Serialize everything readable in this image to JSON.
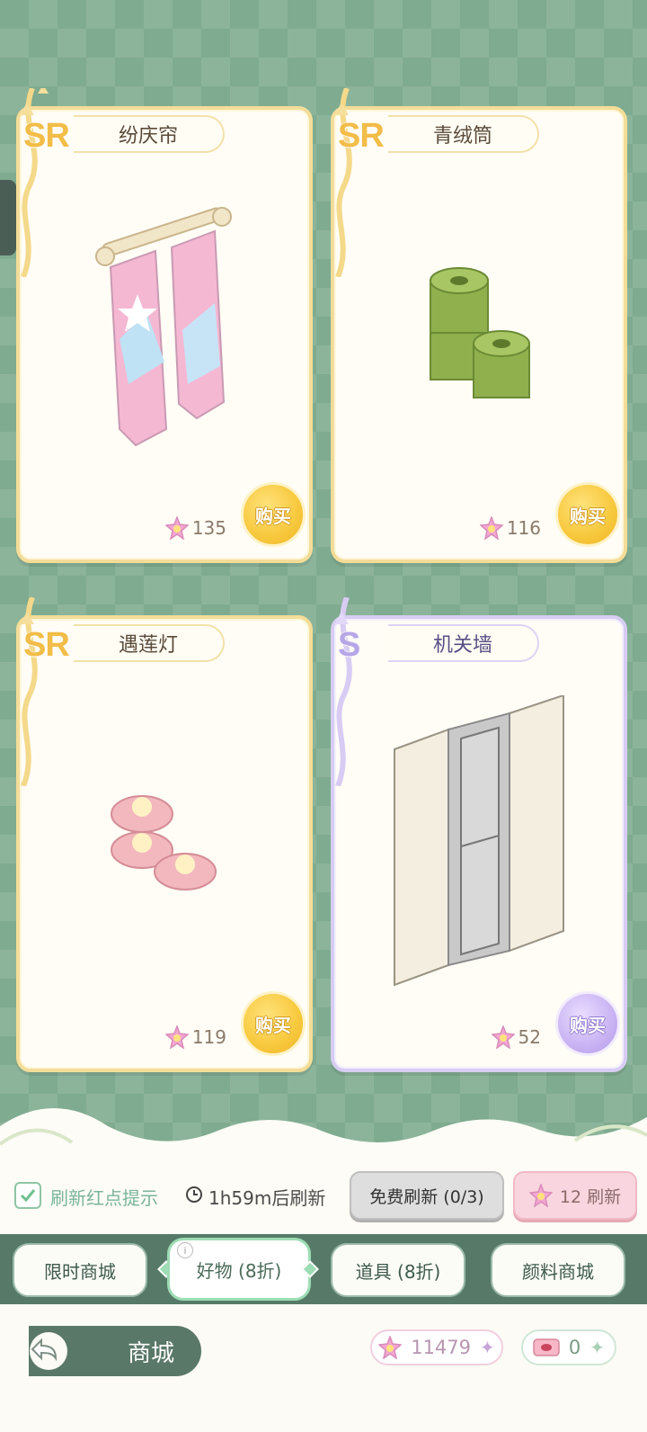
{
  "items": [
    {
      "rarity": "SR",
      "name": "纷庆帘",
      "price": "135",
      "buy_label": "购买"
    },
    {
      "rarity": "SR",
      "name": "青绒筒",
      "price": "116",
      "buy_label": "购买"
    },
    {
      "rarity": "SR",
      "name": "遇莲灯",
      "price": "119",
      "buy_label": "购买"
    },
    {
      "rarity": "S",
      "name": "机关墙",
      "price": "52",
      "buy_label": "购买"
    }
  ],
  "refresh": {
    "reminder_label": "刷新红点提示",
    "reminder_checked": true,
    "timer": "1h59m后刷新",
    "free_button": "免费刷新 (0/3)",
    "paid_button": "12 刷新"
  },
  "tabs": [
    {
      "label": "限时商城",
      "active": false
    },
    {
      "label": "好物 (8折)",
      "active": true
    },
    {
      "label": "道具 (8折)",
      "active": false
    },
    {
      "label": "颜料商城",
      "active": false
    }
  ],
  "footer": {
    "title": "商城",
    "star_currency": "11479",
    "ticket_currency": "0"
  },
  "colors": {
    "background": "#7fab90",
    "sr_gold": "#f2bd48",
    "s_purple": "#b7a6e6",
    "tab_bar": "#577a68"
  },
  "icons": [
    "star-currency-icon",
    "clock-icon",
    "back-arrow-icon",
    "ticket-icon",
    "checkmark-icon",
    "plus-icon"
  ]
}
